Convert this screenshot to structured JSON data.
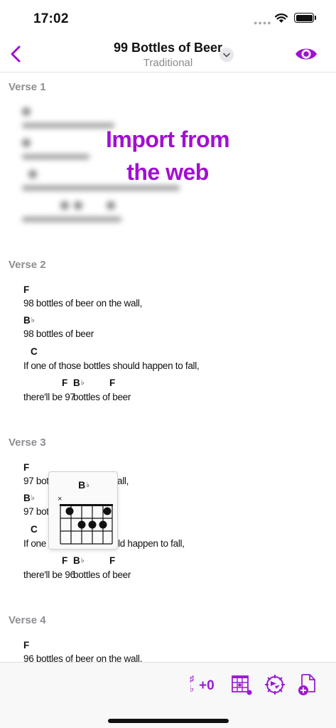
{
  "status": {
    "time": "17:02"
  },
  "nav": {
    "title": "99 Bottles of Beer",
    "subtitle": "Traditional"
  },
  "overlay": {
    "line1": "Import from",
    "line2": "the web"
  },
  "verses": {
    "v1": {
      "label": "Verse 1"
    },
    "v2": {
      "label": "Verse 2",
      "chord1": "F",
      "line1": "98 bottles of beer on the wall,",
      "chord2": "B",
      "line2": "98 bottles of beer",
      "chord3": "C",
      "line3": "If one of those bottles should happen to fall,",
      "chord4a": "F",
      "chord4b": "B",
      "chord4c": "F",
      "line4a": "there'll be 97",
      "line4b": "bottles of beer"
    },
    "v3": {
      "label": "Verse 3",
      "chord1": "F",
      "line1a": "97 bott",
      "line1b": "all,",
      "chord2": "B",
      "line2": "97 bott",
      "chord3": "C",
      "line3a": "If one o",
      "line3b": "ld happen to fall,",
      "chord4a": "F",
      "chord4b": "B",
      "chord4c": "F",
      "line4a": "there'll be 96",
      "line4b": "bottles of beer"
    },
    "v4": {
      "label": "Verse 4",
      "chord1": "F",
      "line1": "96 bottles of beer on the wall."
    }
  },
  "flat_symbol": "♭",
  "chord_popup": {
    "name": "B",
    "muted": "×"
  },
  "toolbar": {
    "transpose_sharp": "♯",
    "transpose_flat": "♭",
    "transpose_value": "+0"
  },
  "colors": {
    "accent": "#a20fd2",
    "label_gray": "#8e8e93"
  },
  "icons": [
    "chevron-left-icon",
    "chevron-down-icon",
    "eye-icon",
    "chord-grid-icon",
    "settings-gear-icon",
    "new-document-icon",
    "wifi-icon",
    "battery-icon"
  ]
}
